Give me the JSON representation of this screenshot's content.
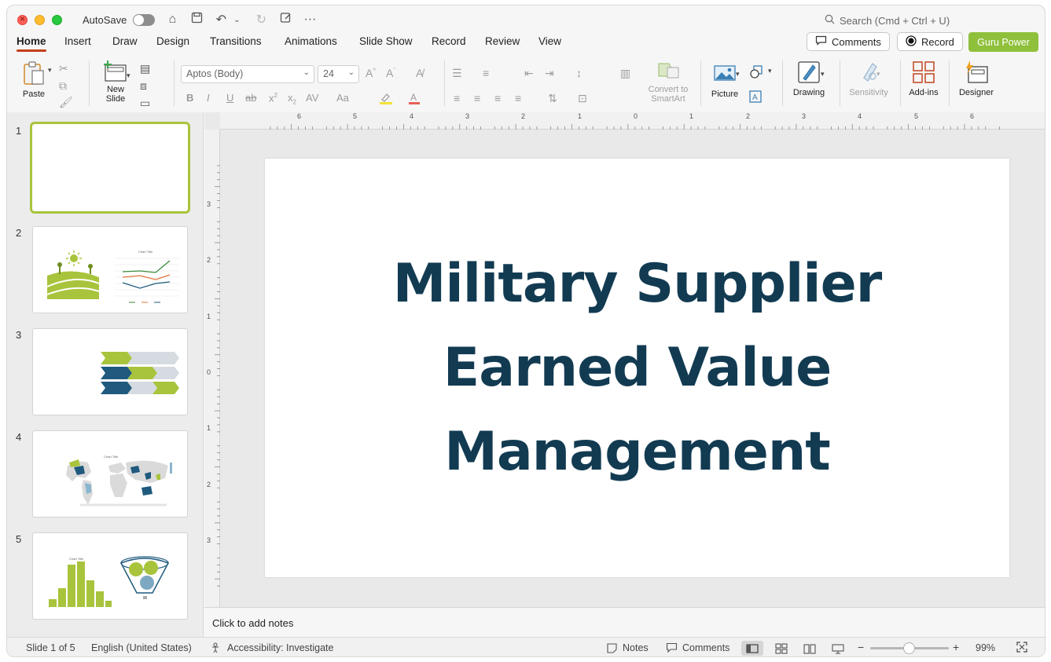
{
  "titlebar": {
    "autosave_label": "AutoSave",
    "search_placeholder": "Search (Cmd + Ctrl + U)"
  },
  "tabs": [
    {
      "label": "Home"
    },
    {
      "label": "Insert"
    },
    {
      "label": "Draw"
    },
    {
      "label": "Design"
    },
    {
      "label": "Transitions"
    },
    {
      "label": "Animations"
    },
    {
      "label": "Slide Show"
    },
    {
      "label": "Record"
    },
    {
      "label": "Review"
    },
    {
      "label": "View"
    }
  ],
  "actions": {
    "comments": "Comments",
    "record": "Record",
    "guru": "Guru Power"
  },
  "ribbon": {
    "paste": "Paste",
    "new_slide_1": "New",
    "new_slide_2": "Slide",
    "font_name": "Aptos (Body)",
    "font_size": "24",
    "convert_1": "Convert to",
    "convert_2": "SmartArt",
    "picture": "Picture",
    "drawing": "Drawing",
    "sensitivity": "Sensitivity",
    "addins": "Add-ins",
    "designer": "Designer"
  },
  "thumbnails": [
    {
      "num": "1"
    },
    {
      "num": "2",
      "chart_title": "Chart Title"
    },
    {
      "num": "3"
    },
    {
      "num": "4",
      "chart_title": "Chart Title"
    },
    {
      "num": "5",
      "chart_title": "Chart Title"
    }
  ],
  "slide": {
    "title_line1": "Military Supplier",
    "title_line2": "Earned Value",
    "title_line3": "Management"
  },
  "notes_placeholder": "Click to add notes",
  "status": {
    "slide_count": "Slide 1 of 5",
    "language": "English (United States)",
    "accessibility": "Accessibility: Investigate",
    "notes": "Notes",
    "comments": "Comments",
    "zoom": "99%"
  },
  "colors": {
    "accent_tab": "#c43e1c",
    "guru_green": "#8fc03b",
    "title_navy": "#123b52",
    "thumb_green": "#a8c43c",
    "thumb_blue": "#1f5a7e"
  },
  "ruler": {
    "h_labels": [
      "6",
      "5",
      "4",
      "3",
      "2",
      "1",
      "0",
      "1",
      "2",
      "3",
      "4",
      "5",
      "6"
    ],
    "v_labels": [
      "3",
      "2",
      "1",
      "0",
      "1",
      "2",
      "3"
    ]
  }
}
